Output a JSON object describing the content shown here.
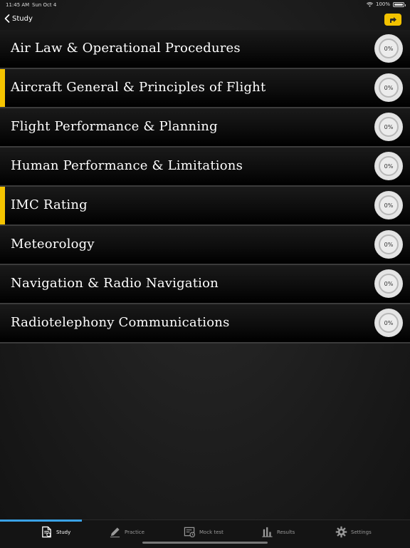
{
  "status_bar": {
    "time": "11:45 AM",
    "date": "Sun Oct 4",
    "battery": "100%"
  },
  "nav": {
    "back_label": "Study"
  },
  "colors": {
    "accent": "#f5c400",
    "tab_indicator": "#3aa2e6"
  },
  "subjects": [
    {
      "label": "Air Law & Operational Procedures",
      "progress": "0%",
      "marked": false
    },
    {
      "label": "Aircraft General & Principles of Flight",
      "progress": "0%",
      "marked": true
    },
    {
      "label": "Flight Performance & Planning",
      "progress": "0%",
      "marked": false
    },
    {
      "label": "Human Performance & Limitations",
      "progress": "0%",
      "marked": false
    },
    {
      "label": "IMC Rating",
      "progress": "0%",
      "marked": true
    },
    {
      "label": "Meteorology",
      "progress": "0%",
      "marked": false
    },
    {
      "label": "Navigation & Radio Navigation",
      "progress": "0%",
      "marked": false
    },
    {
      "label": "Radiotelephony Communications",
      "progress": "0%",
      "marked": false
    }
  ],
  "tabs": [
    {
      "label": "Study",
      "icon": "study-icon",
      "active": true
    },
    {
      "label": "Practice",
      "icon": "pencil-icon",
      "active": false
    },
    {
      "label": "Mock test",
      "icon": "mock-test-icon",
      "active": false
    },
    {
      "label": "Results",
      "icon": "bar-chart-icon",
      "active": false
    },
    {
      "label": "Settings",
      "icon": "gear-icon",
      "active": false
    }
  ]
}
